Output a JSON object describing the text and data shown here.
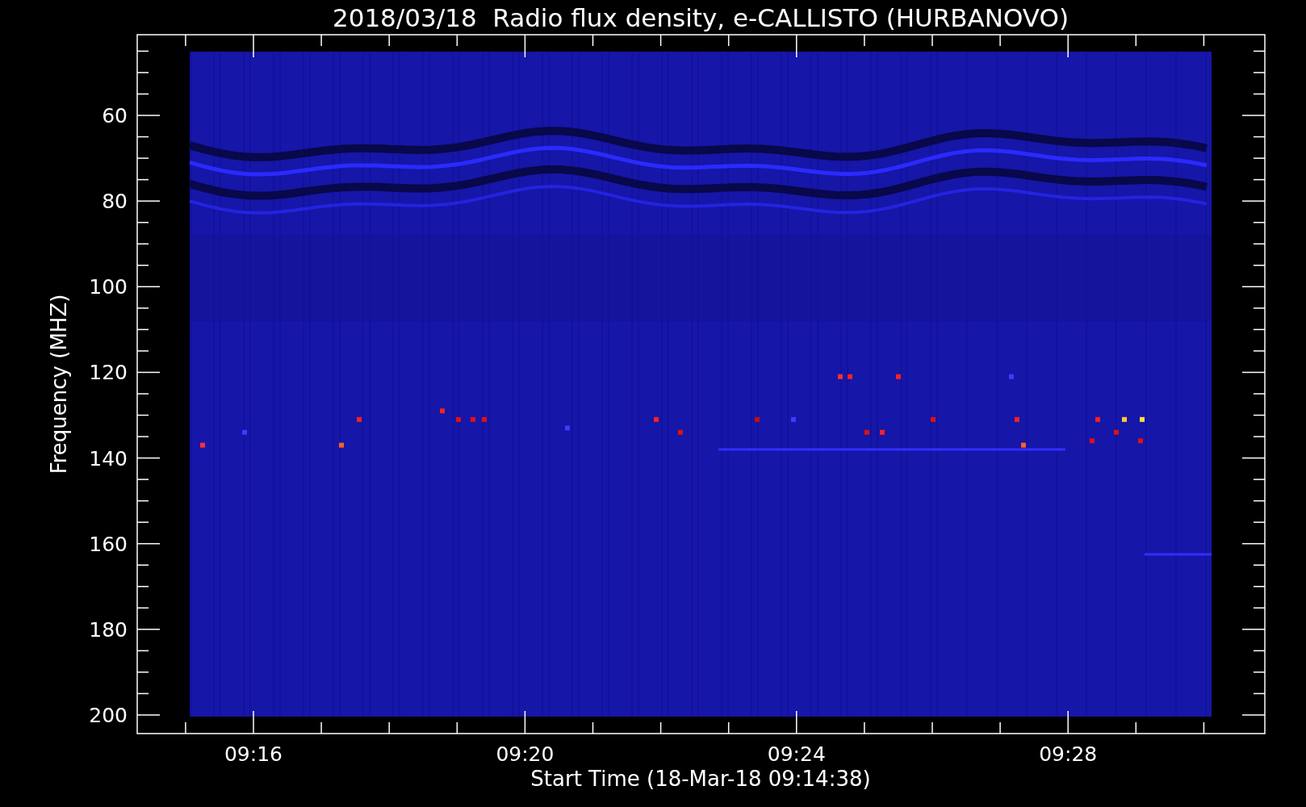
{
  "title": "2018/03/18  Radio flux density, e-CALLISTO (HURBANOVO)",
  "y_axis": {
    "label": "Frequency (MHZ)",
    "ticks": [
      "60",
      "80",
      "100",
      "120",
      "140",
      "160",
      "180",
      "200"
    ]
  },
  "x_axis": {
    "label": "Start Time (18-Mar-18 09:14:38)",
    "ticks": [
      "09:16",
      "09:20",
      "09:24",
      "09:28"
    ]
  }
}
